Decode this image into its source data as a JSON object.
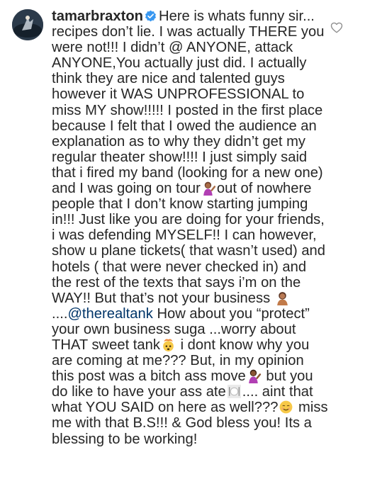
{
  "comment": {
    "username": "tamarbraxton",
    "segments": [
      "Here is whats funny sir... recipes don’t lie. I was actually THERE you were not!!! I didn’t @ ANYONE, attack ANYONE,You actually just did. I actually think they are nice and talented guys however it WAS UNPROFESSIONAL to miss MY show!!!!! I posted in the first place because I felt that I owed the audience an explanation as to why they didn’t get my regular theater show!!!! I just simply said that i fired my band (looking for a new one) and I was going on tour",
      "out of nowhere people that I don’t know starting jumping in!!! Just like you are doing for your friends, i was defending MYSELF!! I can however, show u plane tickets( that wasn’t used) and hotels ( that were never checked in) and the rest of the texts that says i’m on the WAY!! But that’s not your business",
      "....",
      "How about you “protect” your own business suga ...worry about THAT sweet tank",
      "i dont know why you are coming at me??? But, in my opinion this post was a bitch ass move",
      "but you do like to have your ass ate",
      ".... aint that what YOU SAID on here as well???",
      "miss me with that B.S!!! & God bless you! Its a blessing to be working!"
    ],
    "mention": "@therealtank"
  },
  "icons": {
    "avatar": "profile-avatar",
    "verified": "verified-badge-icon",
    "like": "heart-outline-icon",
    "emoji_shrug": "woman-tipping-hand-emoji",
    "emoji_nails": "woman-facepalm-emoji",
    "emoji_exploding": "exploding-head-emoji",
    "emoji_plate": "plate-fork-knife-emoji",
    "emoji_smile": "relieved-smile-emoji"
  },
  "colors": {
    "text": "#262626",
    "mention": "#003569",
    "verified": "#3897f0",
    "heart": "#8e8e8e"
  }
}
